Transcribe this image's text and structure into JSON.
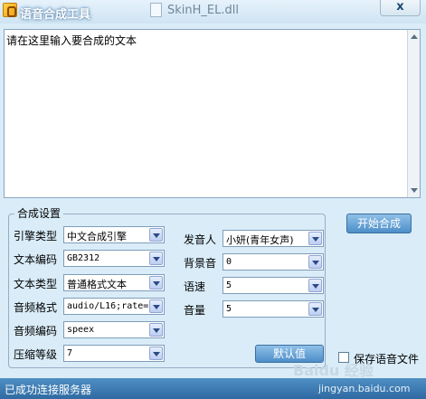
{
  "window": {
    "title": "语音合成工具",
    "background_tab": "SkinH_EL.dll",
    "close_label": "x"
  },
  "text_input": {
    "value": "请在这里输入要合成的文本"
  },
  "start_button": "开始合成",
  "settings": {
    "group_title": "合成设置",
    "engine_type": {
      "label": "引擎类型",
      "value": "中文合成引擎"
    },
    "text_encoding": {
      "label": "文本编码",
      "value": "GB2312"
    },
    "text_type": {
      "label": "文本类型",
      "value": "普通格式文本"
    },
    "audio_format": {
      "label": "音频格式",
      "value": "audio/L16;rate="
    },
    "audio_codec": {
      "label": "音频编码",
      "value": "speex"
    },
    "compression_level": {
      "label": "压缩等级",
      "value": "7"
    },
    "voice": {
      "label": "发音人",
      "value": "小妍(青年女声)"
    },
    "background_sound": {
      "label": "背景音",
      "value": "0"
    },
    "speed": {
      "label": "语速",
      "value": "5"
    },
    "volume": {
      "label": "音量",
      "value": "5"
    },
    "default_button": "默认值"
  },
  "save_audio": {
    "label": "保存语音文件",
    "checked": false
  },
  "status": "已成功连接服务器",
  "watermark": {
    "brand": "Baidu 经验",
    "url": "jingyan.baidu.com"
  }
}
